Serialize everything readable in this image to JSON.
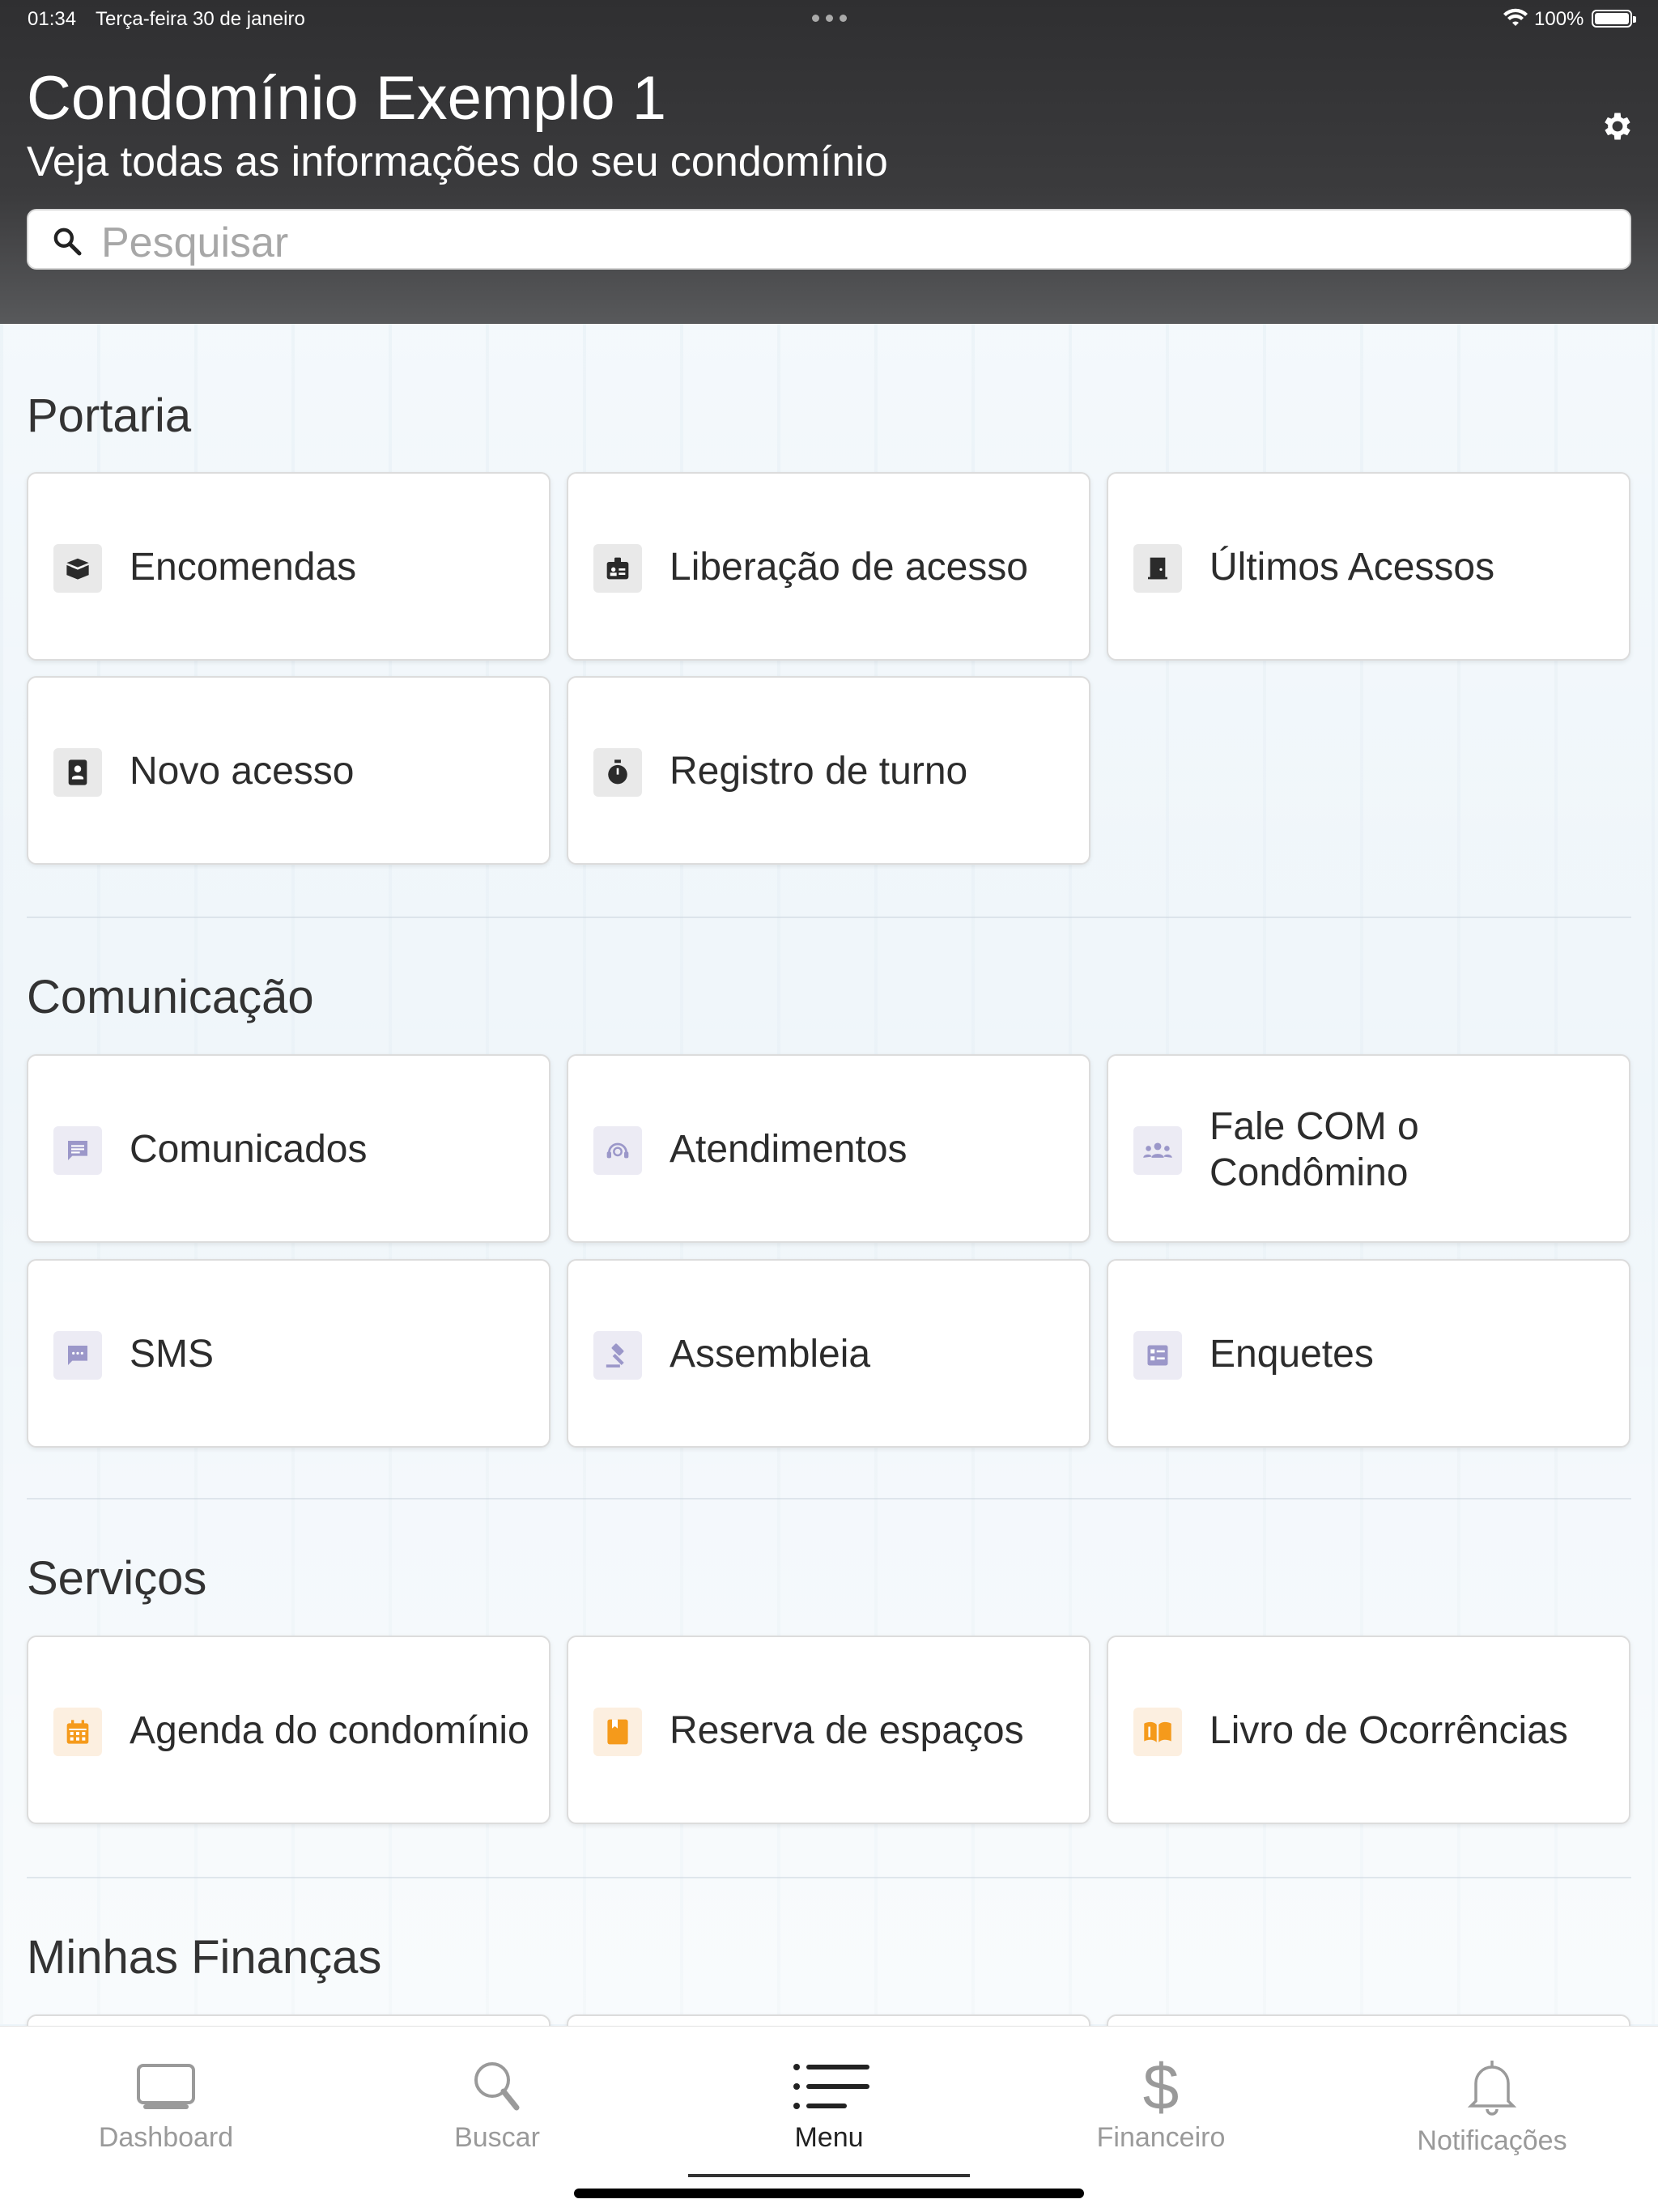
{
  "status_bar": {
    "time": "01:34",
    "date": "Terça-feira 30 de janeiro",
    "battery": "100%"
  },
  "header": {
    "title": "Condomínio Exemplo 1",
    "subtitle": "Veja todas as informações do seu condomínio"
  },
  "search": {
    "placeholder": "Pesquisar"
  },
  "sections": {
    "portaria": {
      "title": "Portaria",
      "items": [
        {
          "label": "Encomendas",
          "icon": "package-icon"
        },
        {
          "label": "Liberação de acesso",
          "icon": "badge-icon"
        },
        {
          "label": "Últimos Acessos",
          "icon": "door-icon"
        },
        {
          "label": "Novo acesso",
          "icon": "contact-card-icon"
        },
        {
          "label": "Registro de turno",
          "icon": "stopwatch-icon"
        }
      ]
    },
    "comunicacao": {
      "title": "Comunicação",
      "items": [
        {
          "label": "Comunicados",
          "icon": "message-icon"
        },
        {
          "label": "Atendimentos",
          "icon": "support-agent-icon"
        },
        {
          "label": "Fale COM o Condômino",
          "icon": "group-icon"
        },
        {
          "label": "SMS",
          "icon": "sms-icon"
        },
        {
          "label": "Assembleia",
          "icon": "gavel-icon"
        },
        {
          "label": "Enquetes",
          "icon": "poll-icon"
        }
      ]
    },
    "servicos": {
      "title": "Serviços",
      "items": [
        {
          "label": "Agenda do condomínio",
          "icon": "calendar-icon"
        },
        {
          "label": "Reserva de espaços",
          "icon": "bookmark-icon"
        },
        {
          "label": "Livro de Ocorrências",
          "icon": "book-icon"
        }
      ]
    },
    "financas": {
      "title": "Minhas Finanças"
    }
  },
  "tabbar": {
    "items": [
      {
        "label": "Dashboard",
        "icon": "monitor-icon"
      },
      {
        "label": "Buscar",
        "icon": "magnifier-icon"
      },
      {
        "label": "Menu",
        "icon": "list-icon"
      },
      {
        "label": "Financeiro",
        "icon": "dollar-icon"
      },
      {
        "label": "Notificações",
        "icon": "bell-icon"
      }
    ],
    "active": "Menu"
  },
  "colors": {
    "header_bg": "#3a3a3c",
    "dark_icon": "#2b2b2b",
    "purple_icon": "#9b97c9",
    "orange_icon": "#f59a1b",
    "tab_inactive": "#9a9a9a"
  }
}
